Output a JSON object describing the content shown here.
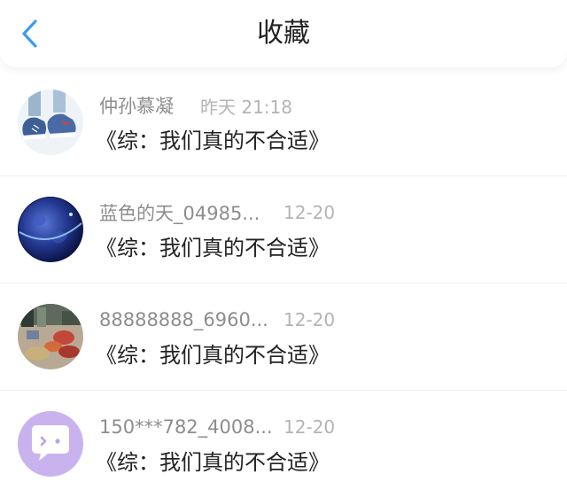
{
  "header": {
    "title": "收藏",
    "back_icon": "chevron-left-icon",
    "accent_color": "#3a9bf5"
  },
  "items": [
    {
      "username": "仲孙慕凝",
      "time": "昨天 21:18",
      "content": "《综：我们真的不合适》",
      "avatar": "sneakers-avatar"
    },
    {
      "username": "蓝色的天_04985...",
      "time": "12-20",
      "content": "《综：我们真的不合适》",
      "avatar": "earth-avatar"
    },
    {
      "username": "88888888_6960...",
      "time": "12-20",
      "content": "《综：我们真的不合适》",
      "avatar": "market-avatar"
    },
    {
      "username": "150***782_4008...",
      "time": "12-20",
      "content": "《综：我们真的不合适》",
      "avatar": "chat-bubble-avatar"
    }
  ]
}
